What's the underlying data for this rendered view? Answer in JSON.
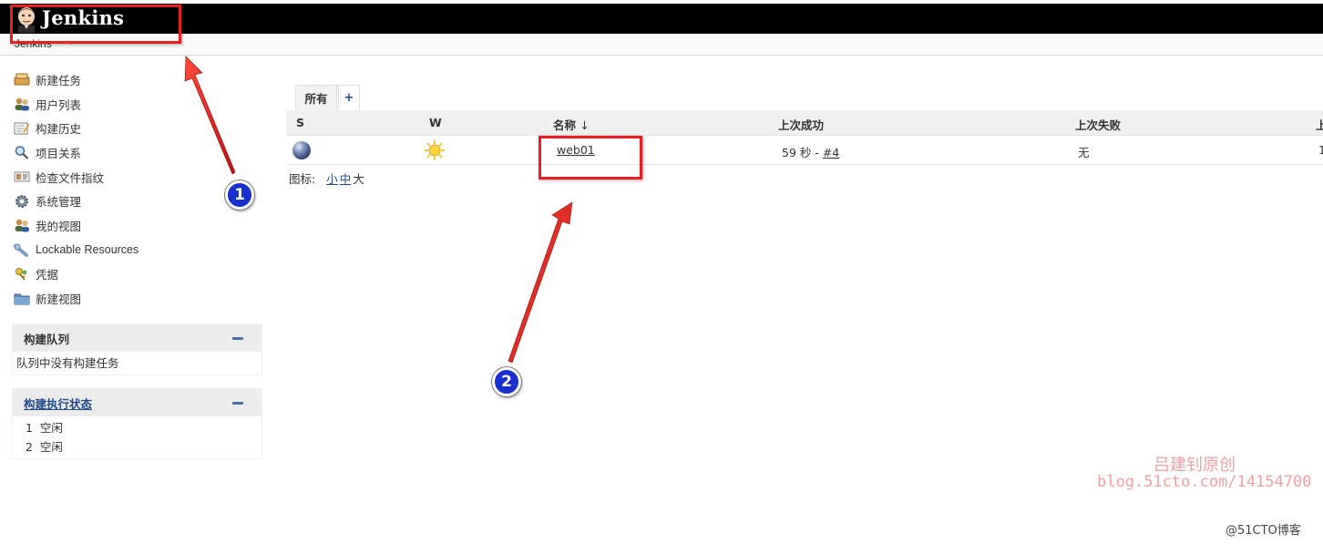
{
  "header": {
    "title": "Jenkins",
    "logo_icon": "jenkins-butler-icon"
  },
  "breadcrumb": {
    "root": "Jenkins",
    "separator": "›"
  },
  "sidebar": {
    "tasks": [
      {
        "label": "新建任务",
        "icon": "new-item-icon"
      },
      {
        "label": "用户列表",
        "icon": "users-icon"
      },
      {
        "label": "构建历史",
        "icon": "build-history-icon"
      },
      {
        "label": "项目关系",
        "icon": "search-icon"
      },
      {
        "label": "检查文件指纹",
        "icon": "fingerprint-icon"
      },
      {
        "label": "系统管理",
        "icon": "gear-icon"
      },
      {
        "label": "我的视图",
        "icon": "my-views-icon"
      },
      {
        "label": "Lockable Resources",
        "icon": "lock-resource-icon"
      },
      {
        "label": "凭据",
        "icon": "credentials-icon"
      },
      {
        "label": "新建视图",
        "icon": "folder-icon"
      }
    ],
    "build_queue": {
      "title": "构建队列",
      "empty_text": "队列中没有构建任务"
    },
    "executors": {
      "title": "构建执行状态",
      "items": [
        {
          "number": "1",
          "status": "空闲"
        },
        {
          "number": "2",
          "status": "空闲"
        }
      ]
    }
  },
  "main": {
    "tabs": [
      {
        "label": "所有"
      },
      {
        "label": "+"
      }
    ],
    "table": {
      "headers": {
        "s": "S",
        "w": "W",
        "name": "名称",
        "name_sort": "↓",
        "last_success": "上次成功",
        "last_failure": "上次失败",
        "last_duration": "上"
      },
      "rows": [
        {
          "name": "web01",
          "last_success_time": "59 秒 - ",
          "last_success_build": "#4",
          "last_failure": "无",
          "last_duration": "1"
        }
      ]
    },
    "icon_size": {
      "label": "图标:",
      "small": "小",
      "medium": "中",
      "large": "大"
    }
  },
  "annotations": {
    "badge1": "1",
    "badge2": "2",
    "color": "#e8201f"
  },
  "watermark": {
    "author": "吕建钊原创",
    "url": "blog.51cto.com/14154700",
    "site": "@51CTO博客"
  }
}
